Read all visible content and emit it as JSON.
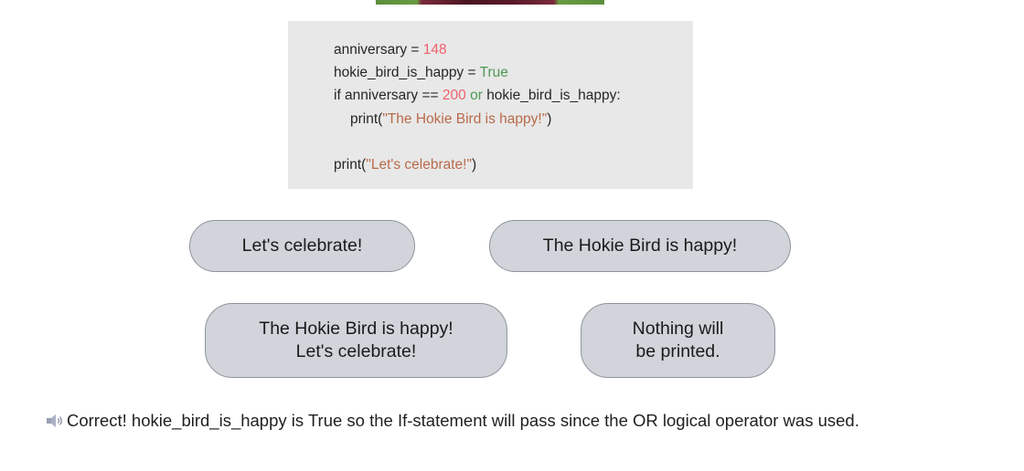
{
  "code": {
    "line1": {
      "name": "anniversary",
      "op": " = ",
      "value": "148"
    },
    "line2": {
      "name": "hokie_bird_is_happy",
      "op": " = ",
      "value": "True"
    },
    "line3": {
      "prefix": "if anniversary == ",
      "num": "200",
      "kw": " or ",
      "suffix": "hokie_bird_is_happy:"
    },
    "line4": {
      "prefix": "print(",
      "str": "\"The Hokie Bird is happy!\"",
      "suffix": ")"
    },
    "line5": {
      "prefix": "print(",
      "str": "\"Let's celebrate!\"",
      "suffix": ")"
    }
  },
  "answers": {
    "a1": "Let's celebrate!",
    "a2": "The Hokie Bird is happy!",
    "a3": "The Hokie Bird is happy!\nLet's celebrate!",
    "a4": "Nothing will\nbe printed."
  },
  "feedback": {
    "icon": "speaker-icon",
    "text": "Correct! hokie_bird_is_happy is True so the If-statement will pass since the OR logical operator was used."
  },
  "colors": {
    "number": "#f0616d",
    "keyword": "#4f9a55",
    "string": "#b86a4a",
    "code_bg": "#e8e8e8",
    "button_bg": "#d1d4db"
  }
}
